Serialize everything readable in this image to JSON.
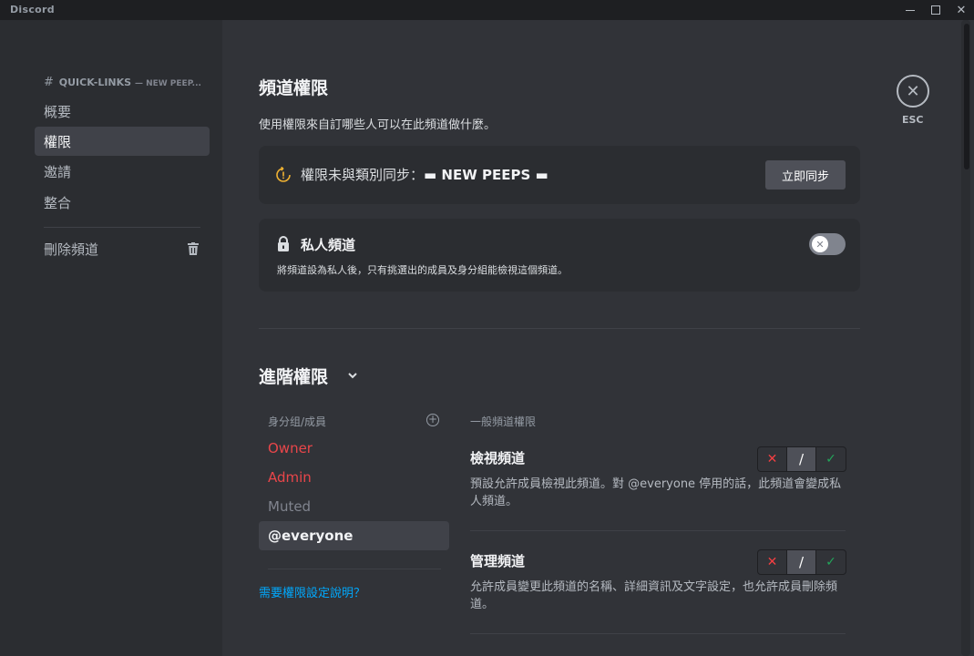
{
  "window": {
    "title": "Discord"
  },
  "sidebar": {
    "channel": "QUICK-LINKS",
    "category": "— NEW PEEP...",
    "items": [
      {
        "label": "概要",
        "active": false
      },
      {
        "label": "權限",
        "active": true
      },
      {
        "label": "邀請",
        "active": false
      },
      {
        "label": "整合",
        "active": false
      }
    ],
    "delete_label": "刪除頻道"
  },
  "main": {
    "title": "頻道權限",
    "description": "使用權限來自訂哪些人可以在此頻道做什麼。",
    "sync": {
      "text": "權限未與類別同步：",
      "category": "▬ NEW PEEPS ▬",
      "button": "立即同步"
    },
    "private": {
      "title": "私人頻道",
      "description": "將頻道設為私人後，只有挑選出的成員及身分組能檢視這個頻道。",
      "enabled": false
    },
    "advanced": {
      "title": "進階權限",
      "roles_header": "身分组/成員",
      "roles": [
        {
          "name": "Owner",
          "color": "#e9464a"
        },
        {
          "name": "Admin",
          "color": "#e9464a"
        },
        {
          "name": "Muted",
          "color": "#80848e"
        },
        {
          "name": "@everyone",
          "color": "#f2f3f5",
          "selected": true
        }
      ],
      "help_link": "需要權限設定說明？",
      "section_title": "一般頻道權限",
      "permissions": [
        {
          "name": "檢視頻道",
          "description": "預設允許成員檢視此頻道。對 @everyone 停用的話，此頻道會變成私人頻道。",
          "state": "neutral"
        },
        {
          "name": "管理頻道",
          "description": "允許成員變更此頻道的名稱、詳細資訊及文字設定，也允許成員刪除頻道。",
          "state": "neutral"
        }
      ]
    },
    "close_label": "ESC"
  },
  "icons": {
    "deny": "✕",
    "neutral": "/",
    "allow": "✓"
  }
}
